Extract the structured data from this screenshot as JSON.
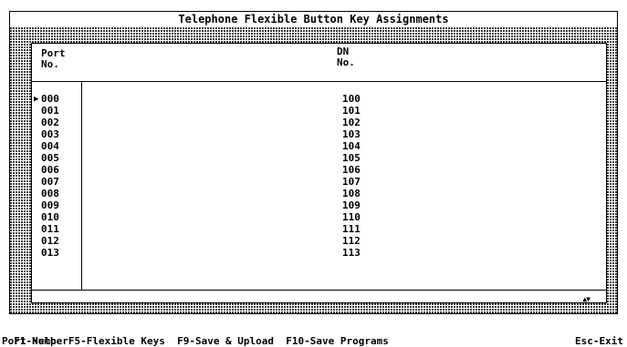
{
  "window": {
    "title": "Telephone Flexible Button Key Assignments"
  },
  "table": {
    "headers": {
      "port_line1": "Port",
      "port_line2": "No.",
      "dn_line1": "DN",
      "dn_line2": "No."
    },
    "selected_row": 0,
    "pointer_glyph": "▶",
    "rows": [
      {
        "port": "000",
        "dn": "100"
      },
      {
        "port": "001",
        "dn": "101"
      },
      {
        "port": "002",
        "dn": "102"
      },
      {
        "port": "003",
        "dn": "103"
      },
      {
        "port": "004",
        "dn": "104"
      },
      {
        "port": "005",
        "dn": "105"
      },
      {
        "port": "006",
        "dn": "106"
      },
      {
        "port": "007",
        "dn": "107"
      },
      {
        "port": "008",
        "dn": "108"
      },
      {
        "port": "009",
        "dn": "109"
      },
      {
        "port": "010",
        "dn": "110"
      },
      {
        "port": "011",
        "dn": "111"
      },
      {
        "port": "012",
        "dn": "112"
      },
      {
        "port": "013",
        "dn": "113"
      }
    ],
    "scroll_arrows": "▲▼"
  },
  "function_keys": {
    "help": "F1-Help",
    "flex": "F5-Flexible Keys",
    "save_upload": "F9-Save & Upload",
    "save_programs": "F10-Save Programs",
    "exit": "Esc-Exit"
  },
  "status_line": "Port Number"
}
